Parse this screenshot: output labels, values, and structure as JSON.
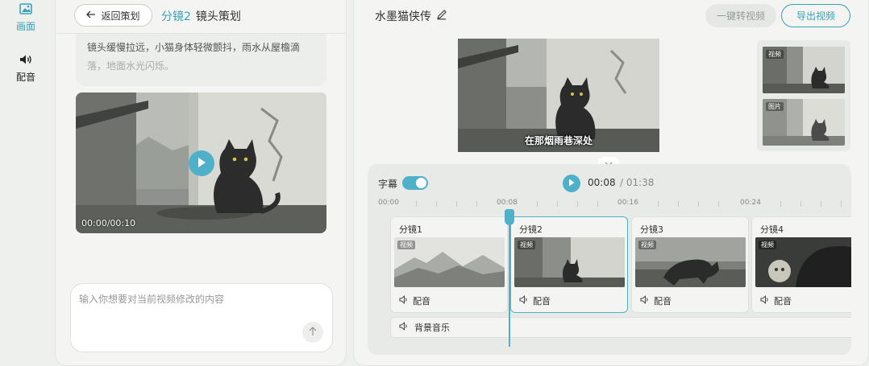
{
  "rail": {
    "items": [
      {
        "label": "画面",
        "icon": "image-icon",
        "active": true
      },
      {
        "label": "配音",
        "icon": "speaker-icon",
        "active": false
      }
    ]
  },
  "left": {
    "back_label": "返回策划",
    "title_highlight": "分镜2",
    "title": "镜头策划",
    "description": "镜头缓慢拉远，小猫身体轻微颤抖，雨水从屋檐滴",
    "description_faded": "落，地面水光闪烁。",
    "video_time": "00:00/00:10",
    "prompt_placeholder": "输入你想要对当前视频修改的内容"
  },
  "right": {
    "project_title": "水墨猫侠传",
    "convert_label": "一键转视频",
    "export_label": "导出视频",
    "subtitle_overlay": "在那烟雨巷深处",
    "thumbs": [
      {
        "tag": "视频"
      },
      {
        "tag": "图片"
      }
    ],
    "subtitle_label": "字幕",
    "subtitle_on": true,
    "current_time": "00:08",
    "total_time": "/ 01:38",
    "ruler": [
      "00:00",
      "00:08",
      "00:16",
      "00:24"
    ],
    "clips": [
      {
        "name": "分镜1",
        "tag": "视频",
        "dub": "配音",
        "active": false
      },
      {
        "name": "分镜2",
        "tag": "视频",
        "dub": "配音",
        "active": true
      },
      {
        "name": "分镜3",
        "tag": "视频",
        "dub": "配音",
        "active": false
      },
      {
        "name": "分镜4",
        "tag": "视频",
        "dub": "配音",
        "active": false
      }
    ],
    "bgm_label": "背景音乐"
  },
  "colors": {
    "accent": "#4fb0c9",
    "accent_text": "#3aa0b8",
    "panel": "#f4f5f3",
    "background": "#eef0ee"
  }
}
